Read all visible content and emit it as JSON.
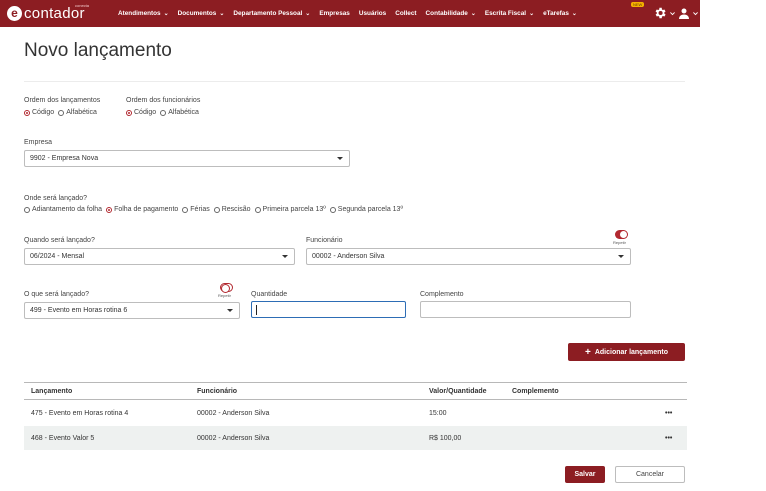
{
  "brand": {
    "mark": "e",
    "name": "contador",
    "sup": "conecta"
  },
  "nav": {
    "items": [
      {
        "label": "Atendimentos",
        "has_menu": true
      },
      {
        "label": "Documentos",
        "has_menu": true
      },
      {
        "label": "Departamento Pessoal",
        "has_menu": true
      },
      {
        "label": "Empresas",
        "has_menu": false
      },
      {
        "label": "Usuários",
        "has_menu": false
      },
      {
        "label": "Collect",
        "has_menu": false
      },
      {
        "label": "Contabilidade",
        "has_menu": true
      },
      {
        "label": "Escrita Fiscal",
        "has_menu": true
      },
      {
        "label": "eTarefas",
        "has_menu": true
      }
    ],
    "new_badge": "NEW",
    "chevron": "⌄",
    "icons": [
      "gear-icon",
      "user-icon"
    ],
    "bg_color": "#8c1d22"
  },
  "page": {
    "title": "Novo lançamento"
  },
  "order_lancamentos": {
    "label": "Ordem dos lançamentos",
    "options": [
      {
        "label": "Código",
        "selected": true
      },
      {
        "label": "Alfabética",
        "selected": false
      }
    ]
  },
  "order_funcionarios": {
    "label": "Ordem dos funcionários",
    "options": [
      {
        "label": "Código",
        "selected": true
      },
      {
        "label": "Alfabética",
        "selected": false
      }
    ]
  },
  "empresa": {
    "label": "Empresa",
    "value": "9902 - Empresa Nova"
  },
  "onde": {
    "label": "Onde será lançado?",
    "options": [
      {
        "label": "Adiantamento da folha",
        "selected": false
      },
      {
        "label": "Folha de pagamento",
        "selected": true
      },
      {
        "label": "Férias",
        "selected": false
      },
      {
        "label": "Rescisão",
        "selected": false
      },
      {
        "label": "Primeira parcela 13º",
        "selected": false
      },
      {
        "label": "Segunda parcela 13º",
        "selected": false
      }
    ]
  },
  "quando": {
    "label": "Quando será lançado?",
    "value": "06/2024 - Mensal"
  },
  "funcionario": {
    "label": "Funcionário",
    "value": "00002 - Anderson Silva",
    "repeat_label": "Repetir",
    "repeat_on": true
  },
  "oque": {
    "label": "O que será lançado?",
    "value": "499 - Evento em Horas rotina 6",
    "repeat_label": "Repetir",
    "repeat_on": false
  },
  "quantidade": {
    "label": "Quantidade",
    "value": ""
  },
  "complemento": {
    "label": "Complemento",
    "value": ""
  },
  "add_button": {
    "icon": "+",
    "label": "Adicionar lançamento"
  },
  "table": {
    "columns": [
      "Lançamento",
      "Funcionário",
      "Valor/Quantidade",
      "Complemento"
    ],
    "rows": [
      {
        "lancamento": "475 - Evento em Horas rotina 4",
        "funcionario": "00002 - Anderson Silva",
        "valor": "15:00",
        "complemento": "",
        "menu": "•••"
      },
      {
        "lancamento": "468 - Evento Valor 5",
        "funcionario": "00002 - Anderson Silva",
        "valor": "R$ 100,00",
        "complemento": "",
        "menu": "•••"
      }
    ]
  },
  "footer": {
    "save_label": "Salvar",
    "cancel_label": "Cancelar"
  }
}
